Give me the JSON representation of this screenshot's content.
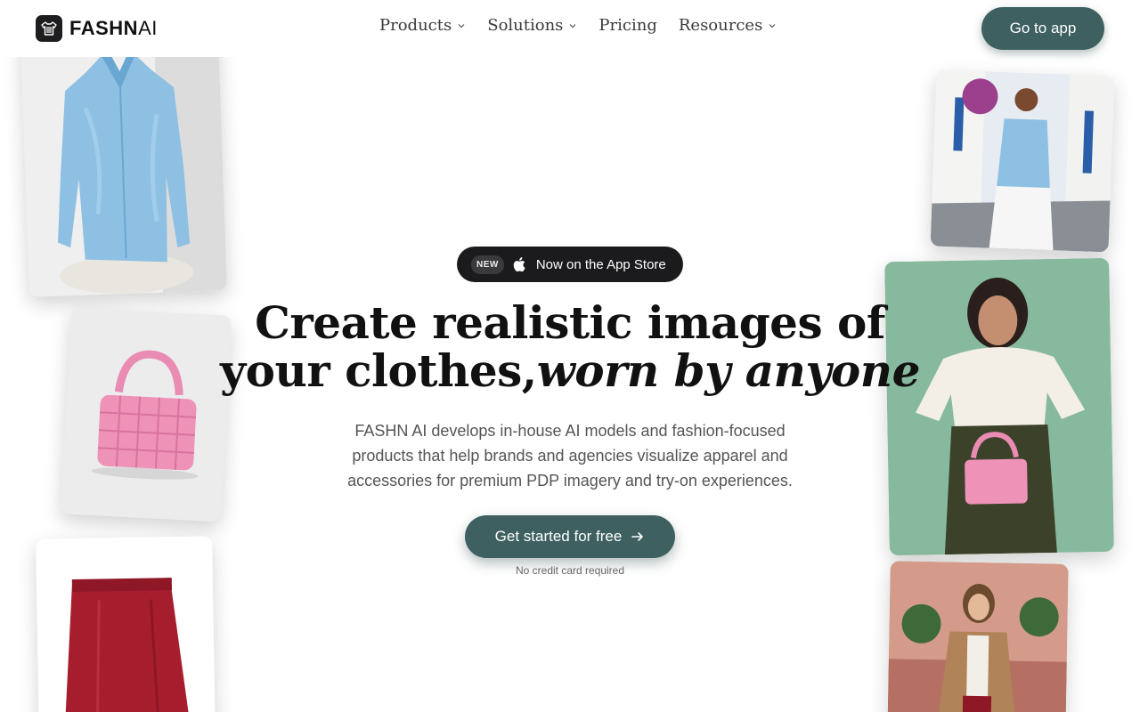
{
  "header": {
    "logo": {
      "bold": "FASHN",
      "thin": "AI"
    },
    "nav": [
      {
        "label": "Products",
        "has_dropdown": true
      },
      {
        "label": "Solutions",
        "has_dropdown": true
      },
      {
        "label": "Pricing",
        "has_dropdown": false
      },
      {
        "label": "Resources",
        "has_dropdown": true
      }
    ],
    "go_app_label": "Go to app"
  },
  "hero": {
    "badge_new": "NEW",
    "badge_text": "Now on the App Store",
    "headline_line1": "Create realistic images of",
    "headline_line2_plain": "your clothes,",
    "headline_line2_italic": "worn by anyone",
    "subtext": "FASHN AI develops in-house AI models and fashion-focused products that help brands and agencies visualize apparel and accessories for premium PDP imagery and try-on experiences.",
    "cta_label": "Get started for free",
    "cta_note": "No credit card required"
  },
  "colors": {
    "brand": "#3e6060",
    "badge_bg": "#1b1b1d",
    "text": "#111111"
  },
  "icons": [
    "shirt-logo-icon",
    "chevron-down-icon",
    "apple-icon",
    "arrow-right-icon"
  ],
  "gallery": [
    {
      "subject": "blue satin shirt on mannequin"
    },
    {
      "subject": "pink woven handbag"
    },
    {
      "subject": "red leather skirt"
    },
    {
      "subject": "model in blue shirt on village street"
    },
    {
      "subject": "model in cream blouse holding pink bag"
    },
    {
      "subject": "model in camel coat in cafe"
    }
  ]
}
